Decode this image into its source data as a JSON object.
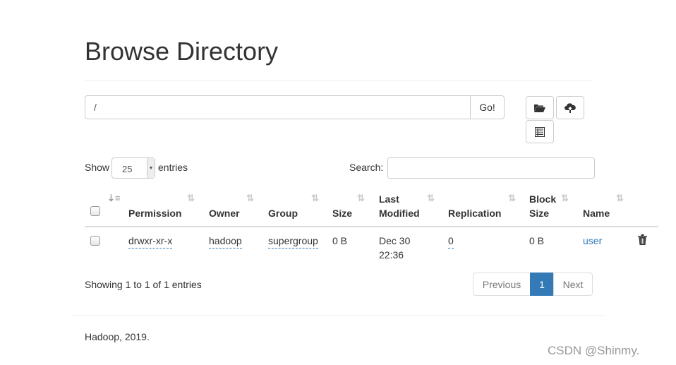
{
  "title": "Browse Directory",
  "path_input": {
    "value": "/"
  },
  "go_label": "Go!",
  "toolbar": {
    "icons": [
      "folder-open-icon",
      "cloud-upload-icon",
      "list-icon"
    ]
  },
  "show_label": "Show",
  "entries_select": "25",
  "entries_label": "entries",
  "search_label": "Search:",
  "search_value": "",
  "columns": [
    "Permission",
    "Owner",
    "Group",
    "Size",
    "Last Modified",
    "Replication",
    "Block Size",
    "Name"
  ],
  "rows": [
    {
      "permission": "drwxr-xr-x",
      "owner": "hadoop",
      "group": "supergroup",
      "size": "0 B",
      "last_modified_date": "Dec 30",
      "last_modified_time": "22:36",
      "replication": "0",
      "block_size": "0 B",
      "name": "user"
    }
  ],
  "info": "Showing 1 to 1 of 1 entries",
  "pagination": {
    "previous": "Previous",
    "current": "1",
    "next": "Next"
  },
  "footer": "Hadoop, 2019.",
  "watermark": "CSDN @Shinmy.",
  "colors": {
    "link": "#337ab7",
    "active_page": "#337ab7"
  }
}
